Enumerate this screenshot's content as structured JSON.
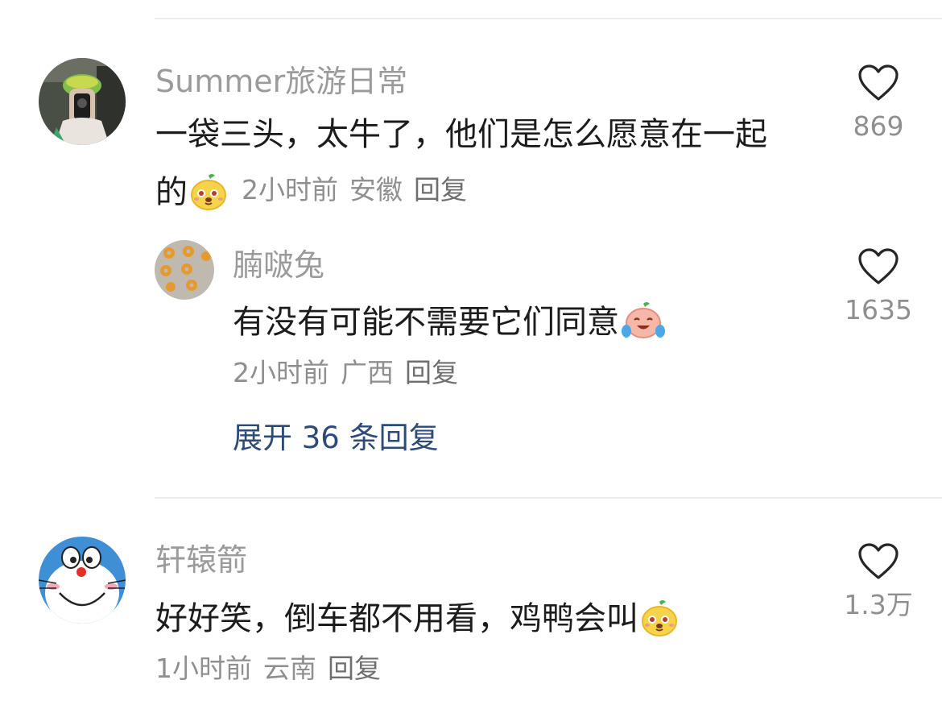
{
  "colors": {
    "username": "#9b9b9b",
    "text": "#1c1c1c",
    "meta": "#8f8f8f",
    "link": "#2d4b78",
    "divider": "#ededed"
  },
  "comments": [
    {
      "username": "Summer旅游日常",
      "text_line1": "一袋三头，太牛了，他们是怎么愿意在一起",
      "text_line2": "的",
      "emoji": "smug-face-emoji",
      "time": "2小时前",
      "location": "安徽",
      "reply": "回复",
      "likes": "869",
      "icon": "heart-outline-icon"
    },
    {
      "username": "腩啵兔",
      "text": "有没有可能不需要它们同意",
      "emoji": "crying-laugh-emoji",
      "time": "2小时前",
      "location": "广西",
      "reply": "回复",
      "likes": "1635",
      "icon": "heart-outline-icon"
    },
    {
      "username": "轩辕箭",
      "text": "好好笑，倒车都不用看，鸡鸭会叫",
      "emoji": "smug-face-emoji",
      "time": "1小时前",
      "location": "云南",
      "reply": "回复",
      "likes": "1.3万",
      "icon": "heart-outline-icon"
    }
  ],
  "expand_replies": "展开 36 条回复"
}
